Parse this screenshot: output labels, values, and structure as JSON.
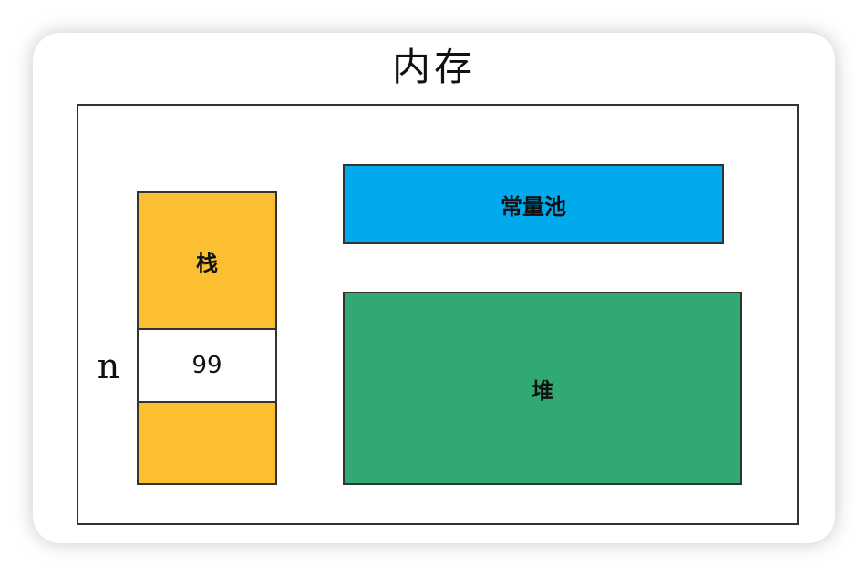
{
  "title": "内存",
  "stack": {
    "label": "栈",
    "variable_name": "n",
    "variable_value": "99"
  },
  "constant_pool": {
    "label": "常量池"
  },
  "heap": {
    "label": "堆"
  },
  "colors": {
    "stack": "#fbbf31",
    "constant_pool": "#00aaec",
    "heap": "#30aa72",
    "border": "#333333"
  }
}
